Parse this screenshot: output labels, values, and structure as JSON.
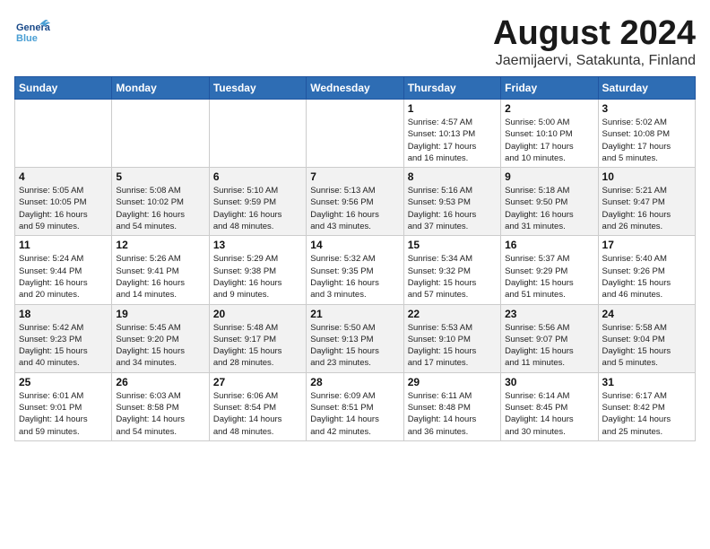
{
  "header": {
    "logo_general": "General",
    "logo_blue": "Blue",
    "title": "August 2024",
    "subtitle": "Jaemijaervi, Satakunta, Finland"
  },
  "weekdays": [
    "Sunday",
    "Monday",
    "Tuesday",
    "Wednesday",
    "Thursday",
    "Friday",
    "Saturday"
  ],
  "weeks": [
    [
      {
        "day": "",
        "info": ""
      },
      {
        "day": "",
        "info": ""
      },
      {
        "day": "",
        "info": ""
      },
      {
        "day": "",
        "info": ""
      },
      {
        "day": "1",
        "info": "Sunrise: 4:57 AM\nSunset: 10:13 PM\nDaylight: 17 hours\nand 16 minutes."
      },
      {
        "day": "2",
        "info": "Sunrise: 5:00 AM\nSunset: 10:10 PM\nDaylight: 17 hours\nand 10 minutes."
      },
      {
        "day": "3",
        "info": "Sunrise: 5:02 AM\nSunset: 10:08 PM\nDaylight: 17 hours\nand 5 minutes."
      }
    ],
    [
      {
        "day": "4",
        "info": "Sunrise: 5:05 AM\nSunset: 10:05 PM\nDaylight: 16 hours\nand 59 minutes."
      },
      {
        "day": "5",
        "info": "Sunrise: 5:08 AM\nSunset: 10:02 PM\nDaylight: 16 hours\nand 54 minutes."
      },
      {
        "day": "6",
        "info": "Sunrise: 5:10 AM\nSunset: 9:59 PM\nDaylight: 16 hours\nand 48 minutes."
      },
      {
        "day": "7",
        "info": "Sunrise: 5:13 AM\nSunset: 9:56 PM\nDaylight: 16 hours\nand 43 minutes."
      },
      {
        "day": "8",
        "info": "Sunrise: 5:16 AM\nSunset: 9:53 PM\nDaylight: 16 hours\nand 37 minutes."
      },
      {
        "day": "9",
        "info": "Sunrise: 5:18 AM\nSunset: 9:50 PM\nDaylight: 16 hours\nand 31 minutes."
      },
      {
        "day": "10",
        "info": "Sunrise: 5:21 AM\nSunset: 9:47 PM\nDaylight: 16 hours\nand 26 minutes."
      }
    ],
    [
      {
        "day": "11",
        "info": "Sunrise: 5:24 AM\nSunset: 9:44 PM\nDaylight: 16 hours\nand 20 minutes."
      },
      {
        "day": "12",
        "info": "Sunrise: 5:26 AM\nSunset: 9:41 PM\nDaylight: 16 hours\nand 14 minutes."
      },
      {
        "day": "13",
        "info": "Sunrise: 5:29 AM\nSunset: 9:38 PM\nDaylight: 16 hours\nand 9 minutes."
      },
      {
        "day": "14",
        "info": "Sunrise: 5:32 AM\nSunset: 9:35 PM\nDaylight: 16 hours\nand 3 minutes."
      },
      {
        "day": "15",
        "info": "Sunrise: 5:34 AM\nSunset: 9:32 PM\nDaylight: 15 hours\nand 57 minutes."
      },
      {
        "day": "16",
        "info": "Sunrise: 5:37 AM\nSunset: 9:29 PM\nDaylight: 15 hours\nand 51 minutes."
      },
      {
        "day": "17",
        "info": "Sunrise: 5:40 AM\nSunset: 9:26 PM\nDaylight: 15 hours\nand 46 minutes."
      }
    ],
    [
      {
        "day": "18",
        "info": "Sunrise: 5:42 AM\nSunset: 9:23 PM\nDaylight: 15 hours\nand 40 minutes."
      },
      {
        "day": "19",
        "info": "Sunrise: 5:45 AM\nSunset: 9:20 PM\nDaylight: 15 hours\nand 34 minutes."
      },
      {
        "day": "20",
        "info": "Sunrise: 5:48 AM\nSunset: 9:17 PM\nDaylight: 15 hours\nand 28 minutes."
      },
      {
        "day": "21",
        "info": "Sunrise: 5:50 AM\nSunset: 9:13 PM\nDaylight: 15 hours\nand 23 minutes."
      },
      {
        "day": "22",
        "info": "Sunrise: 5:53 AM\nSunset: 9:10 PM\nDaylight: 15 hours\nand 17 minutes."
      },
      {
        "day": "23",
        "info": "Sunrise: 5:56 AM\nSunset: 9:07 PM\nDaylight: 15 hours\nand 11 minutes."
      },
      {
        "day": "24",
        "info": "Sunrise: 5:58 AM\nSunset: 9:04 PM\nDaylight: 15 hours\nand 5 minutes."
      }
    ],
    [
      {
        "day": "25",
        "info": "Sunrise: 6:01 AM\nSunset: 9:01 PM\nDaylight: 14 hours\nand 59 minutes."
      },
      {
        "day": "26",
        "info": "Sunrise: 6:03 AM\nSunset: 8:58 PM\nDaylight: 14 hours\nand 54 minutes."
      },
      {
        "day": "27",
        "info": "Sunrise: 6:06 AM\nSunset: 8:54 PM\nDaylight: 14 hours\nand 48 minutes."
      },
      {
        "day": "28",
        "info": "Sunrise: 6:09 AM\nSunset: 8:51 PM\nDaylight: 14 hours\nand 42 minutes."
      },
      {
        "day": "29",
        "info": "Sunrise: 6:11 AM\nSunset: 8:48 PM\nDaylight: 14 hours\nand 36 minutes."
      },
      {
        "day": "30",
        "info": "Sunrise: 6:14 AM\nSunset: 8:45 PM\nDaylight: 14 hours\nand 30 minutes."
      },
      {
        "day": "31",
        "info": "Sunrise: 6:17 AM\nSunset: 8:42 PM\nDaylight: 14 hours\nand 25 minutes."
      }
    ]
  ]
}
